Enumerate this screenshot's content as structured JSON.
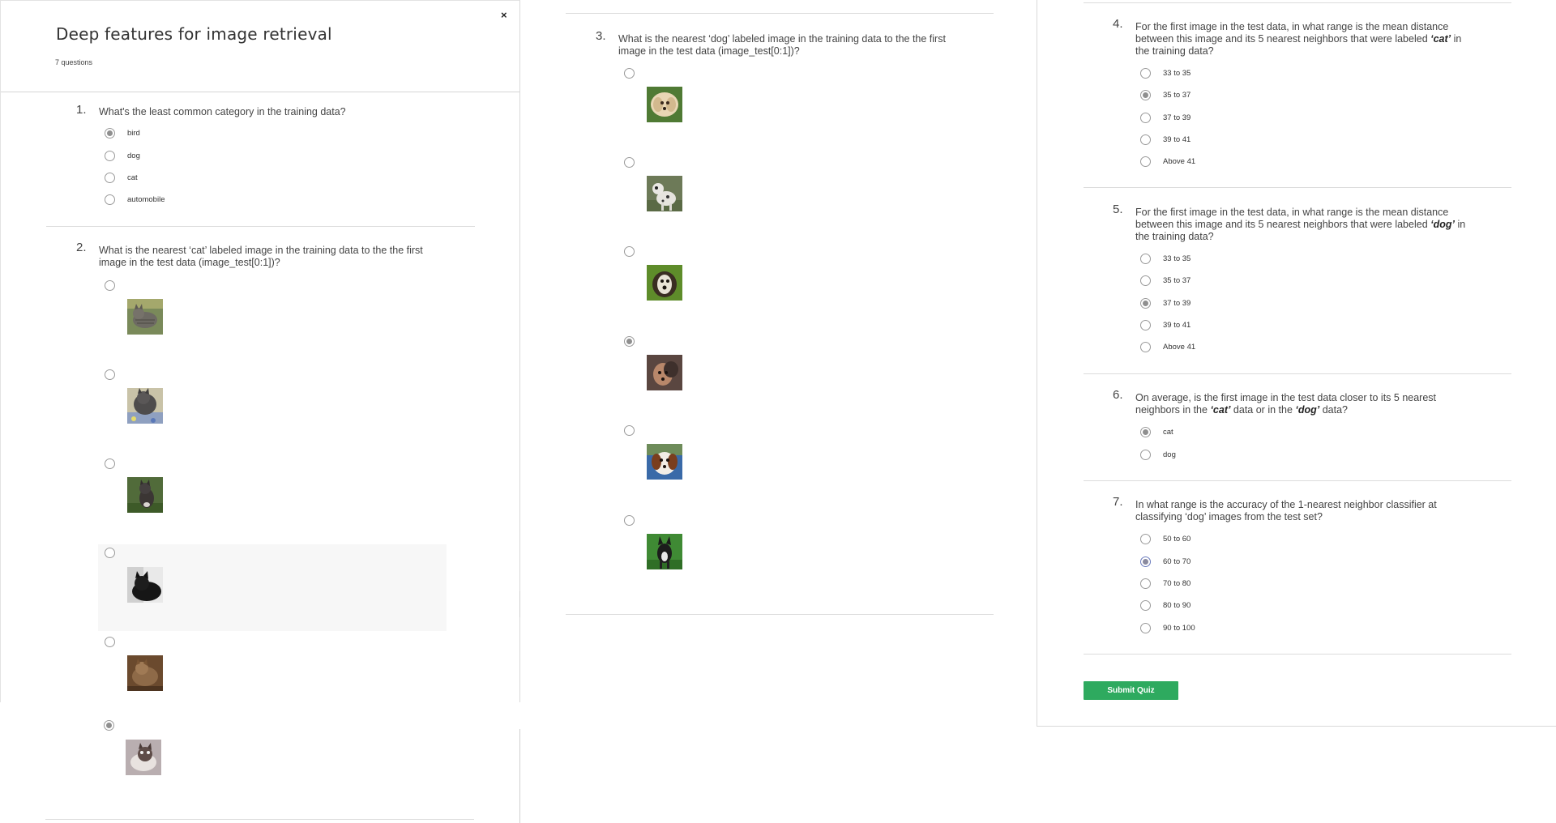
{
  "quiz": {
    "title": "Deep features for image retrieval",
    "question_count": "7 questions",
    "close_label": "×"
  },
  "questions": [
    {
      "number": "1.",
      "text": "What's the least common category in the training data?",
      "options": [
        "bird",
        "dog",
        "cat",
        "automobile"
      ],
      "selected": "bird"
    },
    {
      "number": "2.",
      "text_line1": "What is the nearest ‘cat’ labeled image in the training data to the the first",
      "text_line2": "image in the test data (image_test[0:1])?",
      "options": [
        "cat-image-1",
        "cat-image-2",
        "cat-image-3",
        "cat-image-4",
        "cat-image-5",
        "cat-image-6"
      ],
      "selected_index": 5
    },
    {
      "number": "3.",
      "text_line1": "What is the nearest ‘dog’ labeled image in the training data to the the first",
      "text_line2": "image in the test data (image_test[0:1])?",
      "options": [
        "dog-image-1",
        "dog-image-2",
        "dog-image-3",
        "dog-image-4",
        "dog-image-5",
        "dog-image-6"
      ],
      "selected_index": 3
    },
    {
      "number": "4.",
      "text_line1": "For the first image in the test data, in what range is the mean distance",
      "text_line2_pre": "between this image and its 5 nearest neighbors that were labeled ",
      "text_line2_em": "‘cat’",
      "text_line2_post": " in",
      "text_line3": "the training data?",
      "options": [
        "33 to 35",
        "35 to 37",
        "37 to 39",
        "39 to 41",
        "Above 41"
      ],
      "selected": "35 to 37"
    },
    {
      "number": "5.",
      "text_line1": "For the first image in the test data, in what range is the mean distance",
      "text_line2_pre": "between this image and its 5 nearest neighbors that were labeled ",
      "text_line2_em": "‘dog’",
      "text_line2_post": " in",
      "text_line3": "the training data?",
      "options": [
        "33 to 35",
        "35 to 37",
        "37 to 39",
        "39 to 41",
        "Above 41"
      ],
      "selected": "37 to 39"
    },
    {
      "number": "6.",
      "text_line1": "On average, is the first image in the test data closer to its 5 nearest",
      "text_line2_pre": "neighbors in the ",
      "text_line2_em1": "‘cat’",
      "text_line2_mid": " data or in the ",
      "text_line2_em2": "‘dog’",
      "text_line2_post": " data?",
      "options": [
        "cat",
        "dog"
      ],
      "selected": "cat"
    },
    {
      "number": "7.",
      "text_line1": "In what range is the accuracy of the 1-nearest neighbor classifier at",
      "text_line2": "classifying ‘dog’ images from the test set?",
      "options": [
        "50 to 60",
        "60 to 70",
        "70 to 80",
        "80 to 90",
        "90 to 100"
      ],
      "selected": "60 to 70"
    }
  ],
  "submit": {
    "label": "Submit Quiz"
  },
  "colors": {
    "submit_green": "#2eaa5f",
    "radio_checked": "#8f8f8f",
    "divider": "#dcdcdc"
  }
}
